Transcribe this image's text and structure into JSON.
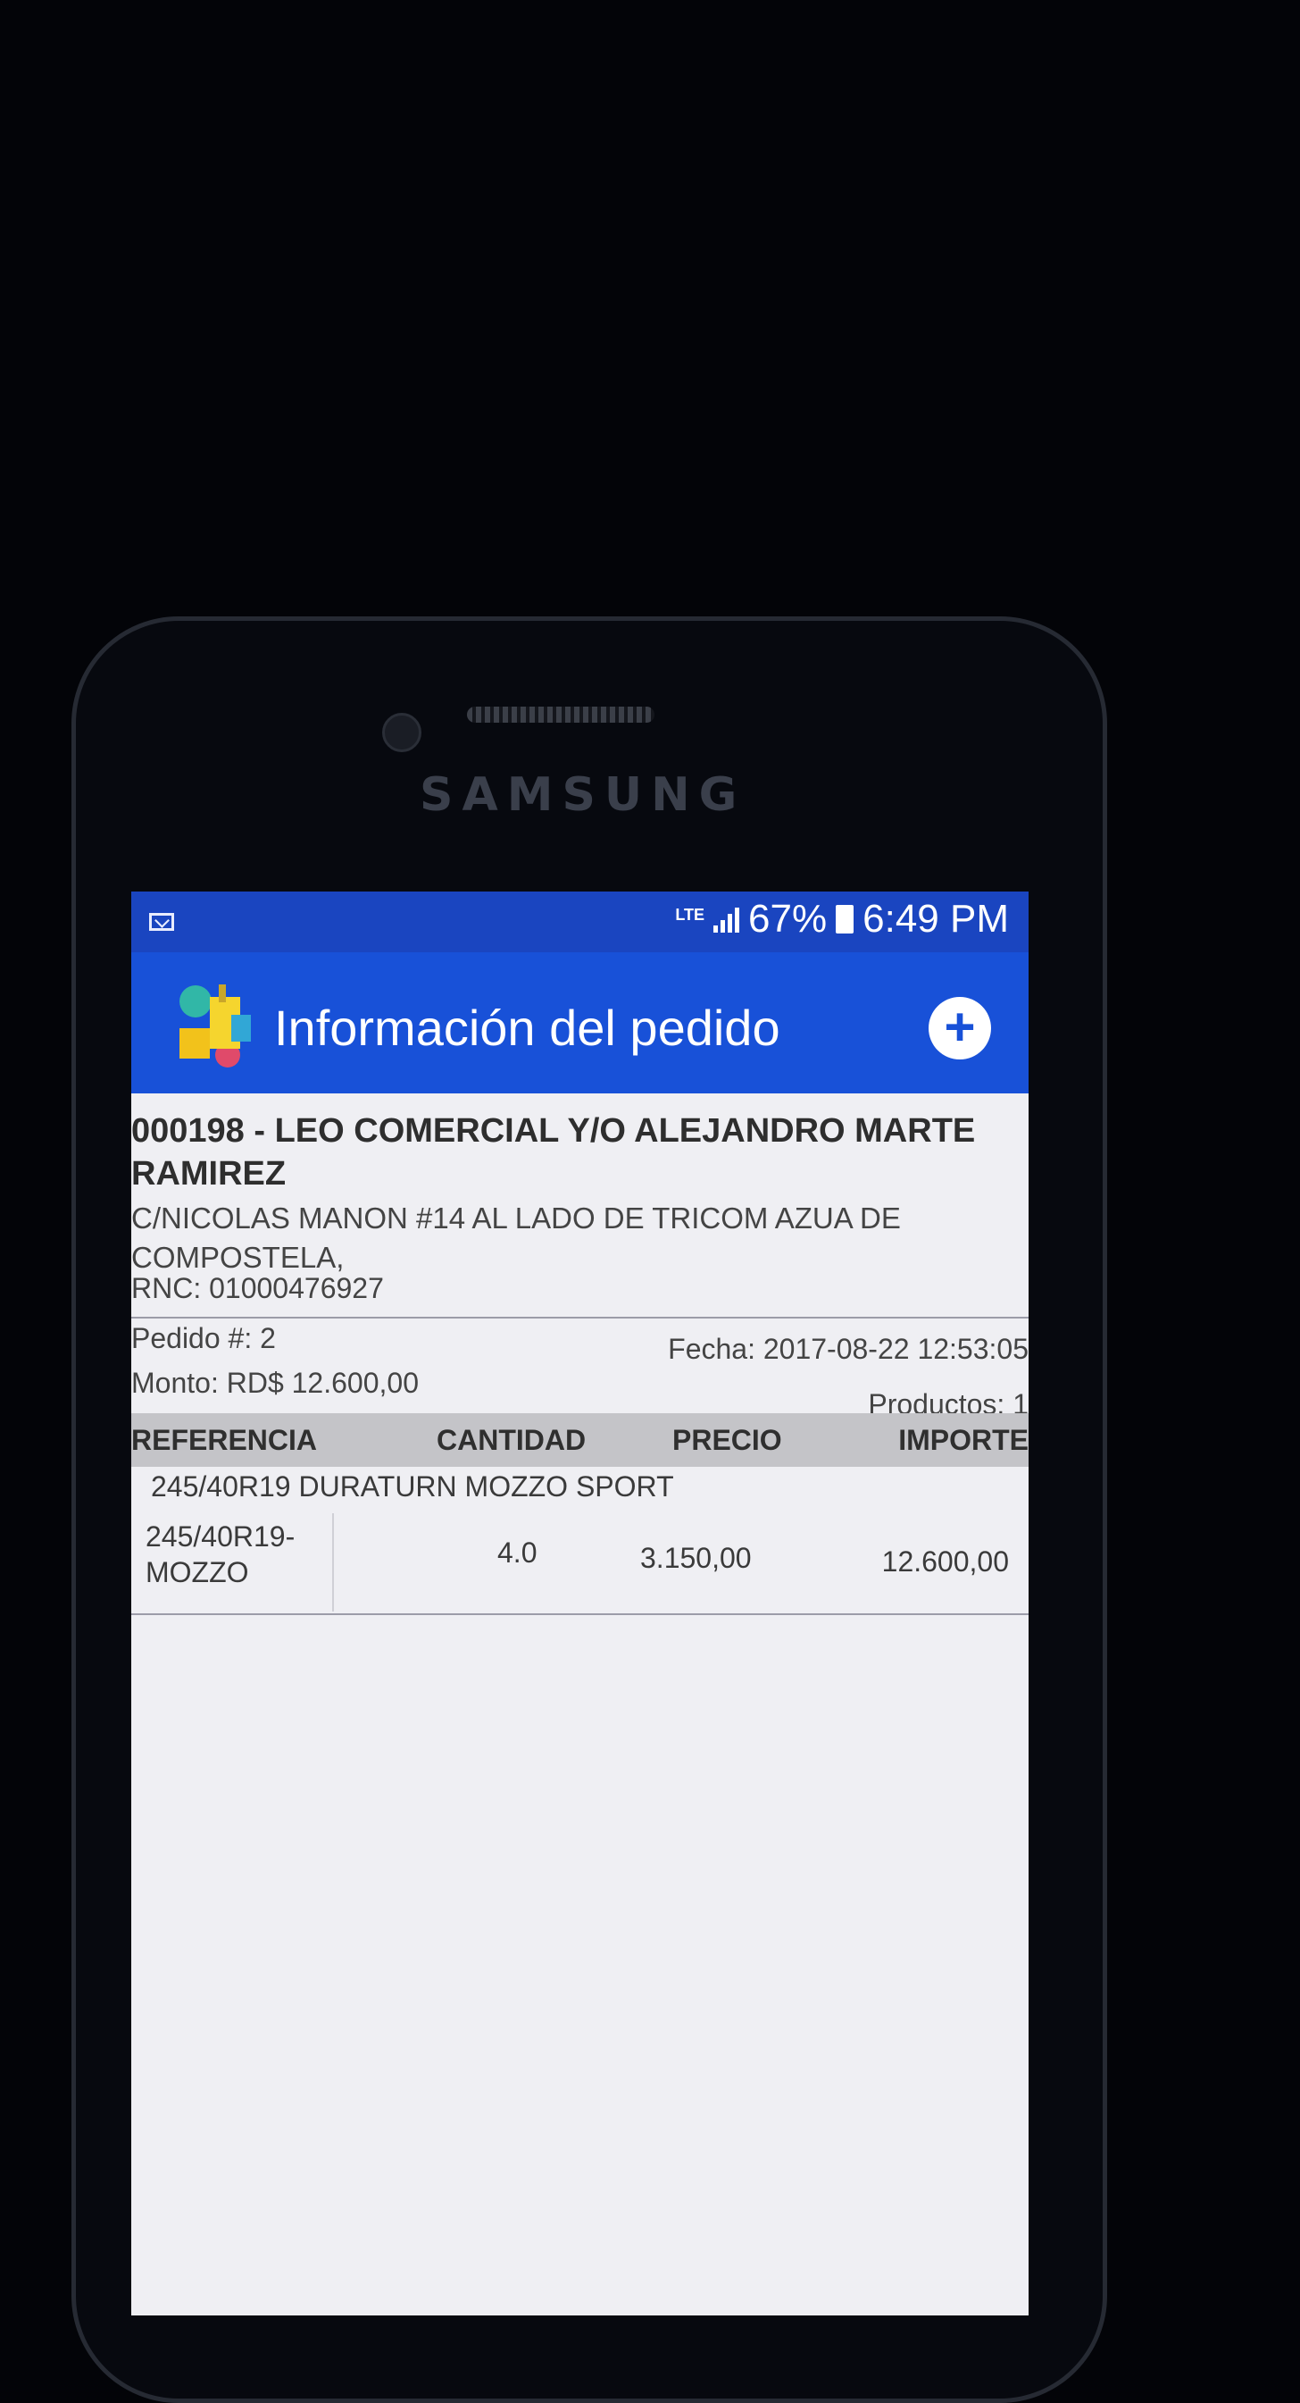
{
  "device": {
    "brand": "SAMSUNG"
  },
  "status_bar": {
    "notification_icon": "mail-icon",
    "network": "LTE",
    "battery": "67%",
    "time": "6:49 PM"
  },
  "app_bar": {
    "title": "Información del pedido",
    "logo_icon": "app-logo-icon",
    "action_icon": "plus-icon",
    "action_label": "+"
  },
  "order": {
    "client_name": "000198 - LEO COMERCIAL Y/O ALEJANDRO MARTE RAMIREZ",
    "address": "C/NICOLAS MANON #14 AL LADO DE TRICOM AZUA DE COMPOSTELA,",
    "rnc": "RNC: 01000476927",
    "order_number": "Pedido #: 2",
    "date": "Fecha: 2017-08-22 12:53:05",
    "total": "Monto: RD$ 12.600,00",
    "products_count": "Productos: 1"
  },
  "table": {
    "headers": [
      "REFERENCIA",
      "CANTIDAD",
      "PRECIO",
      "IMPORTE"
    ],
    "items": [
      {
        "description": "245/40R19 DURATURN MOZZO SPORT",
        "reference": "245/40R19-MOZZO",
        "quantity": "4.0",
        "price": "3.150,00",
        "amount": "12.600,00"
      }
    ]
  },
  "colors": {
    "status_bar": "#1a45c0",
    "app_bar": "#1851d8",
    "screen_background": "#efeff3",
    "table_header": "#c4c4c8"
  }
}
